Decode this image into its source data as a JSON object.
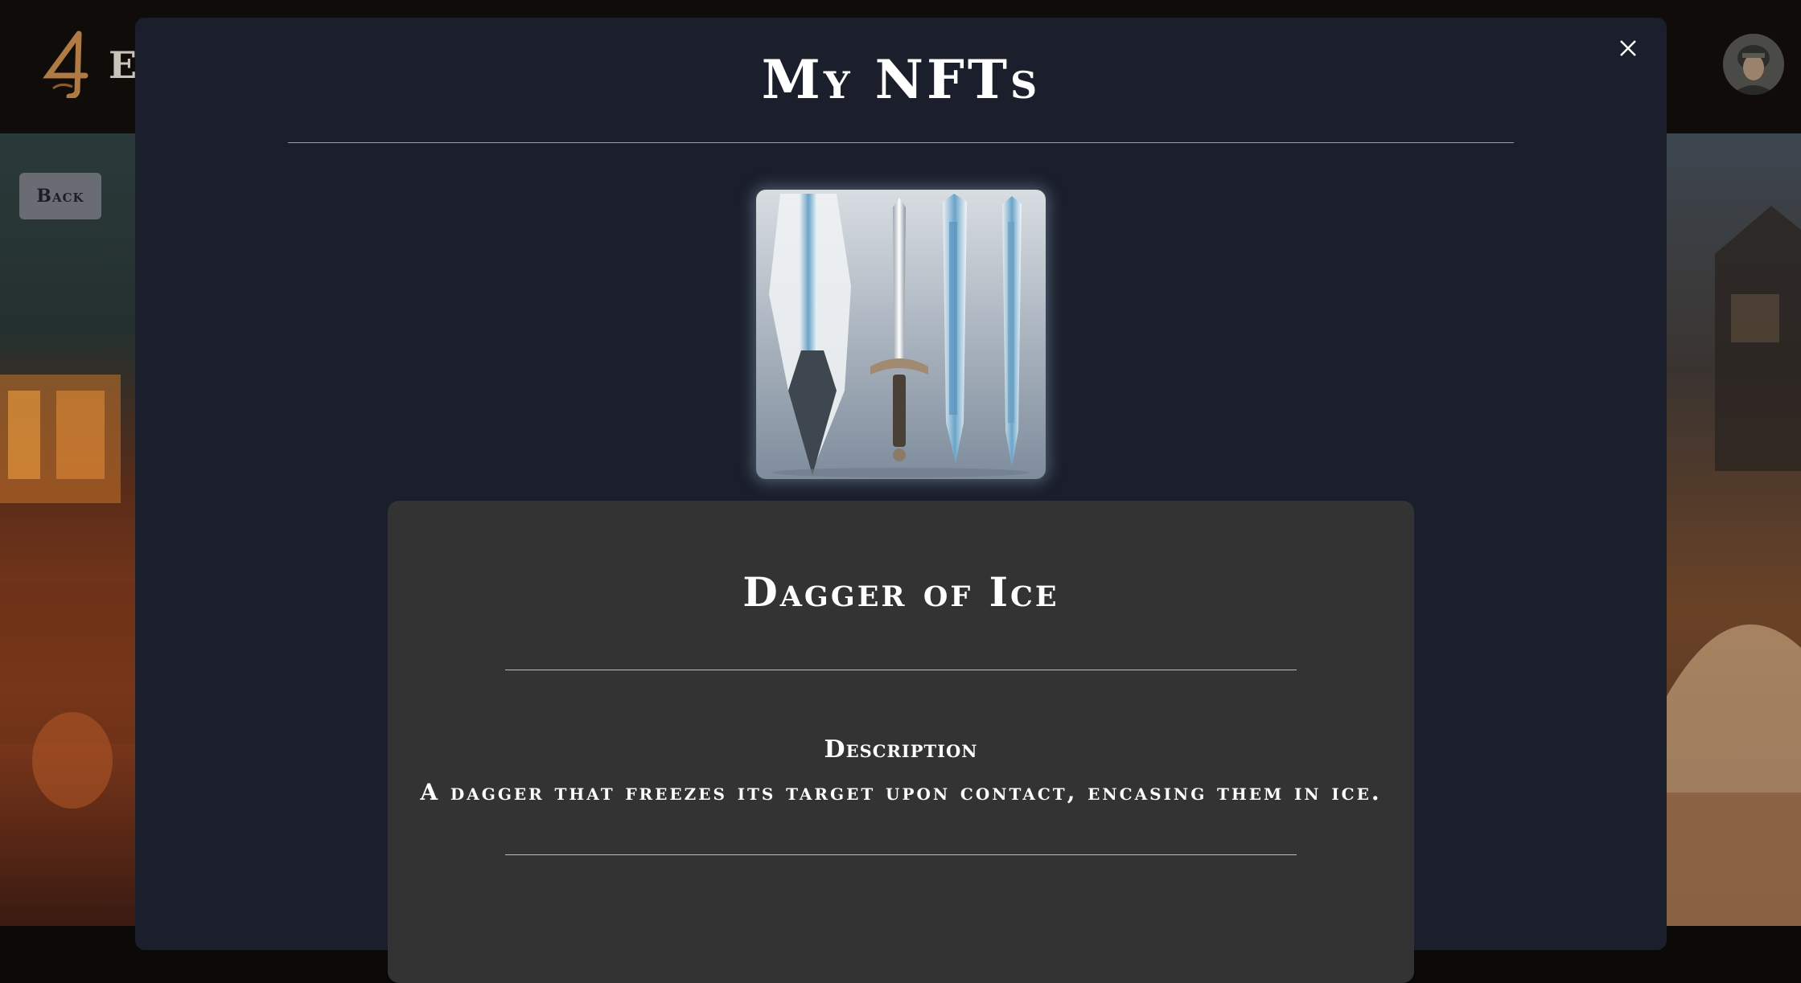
{
  "app": {
    "brand_initial": "E"
  },
  "back_button": {
    "label": "Back"
  },
  "modal": {
    "title": "My NFTs",
    "close_icon": "close-icon"
  },
  "nft": {
    "image_icon": "ice-daggers-artwork",
    "name": "Dagger of Ice",
    "description_label": "Description",
    "description": "A dagger that freezes its target upon contact, encasing them in ice."
  }
}
